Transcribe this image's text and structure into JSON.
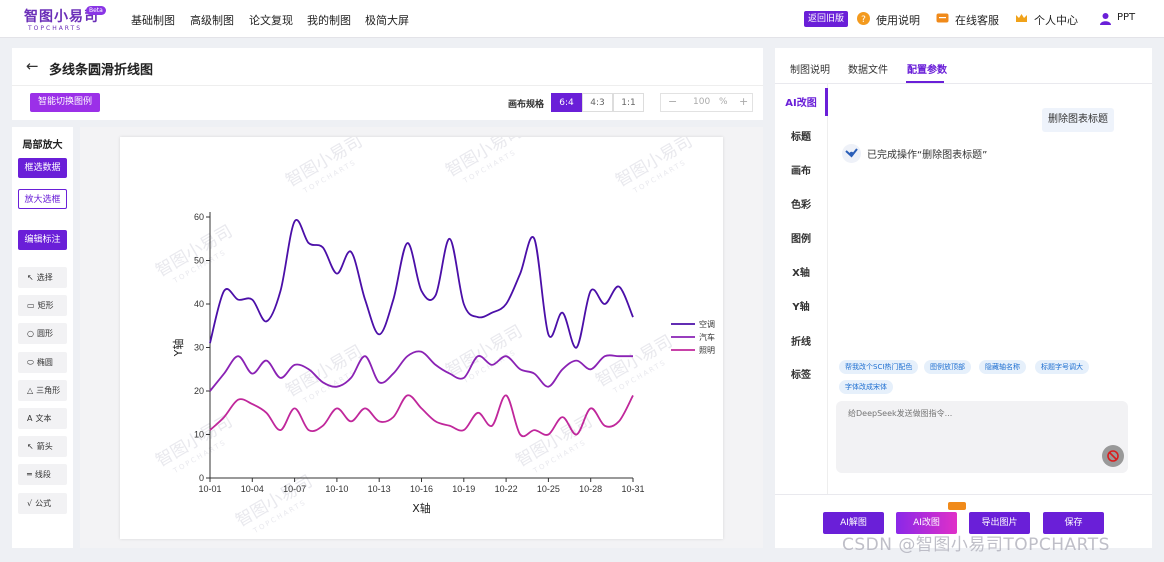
{
  "brand": {
    "name": "智图小易司",
    "sub": "TOPCHARTS",
    "badge": "Beta"
  },
  "nav": [
    "基础制图",
    "高级制图",
    "论文复现",
    "我的制图",
    "极简大屏"
  ],
  "topbar": {
    "old_version": "返回旧版",
    "help": "使用说明",
    "service": "在线客服",
    "center": "个人中心",
    "user": "PPT"
  },
  "page": {
    "title": "多线条圆滑折线图",
    "smart_switch": "智能切换图例"
  },
  "canvas": {
    "ratio_label": "画布规格",
    "ratios": [
      "6:4",
      "4:3",
      "1:1"
    ],
    "active_ratio": "6:4",
    "zoom_minus": "−",
    "zoom_value": "100",
    "zoom_unit": "%",
    "zoom_plus": "+"
  },
  "left_tools": {
    "heading": "局部放大",
    "select_data": "框选数据",
    "zoom_box": "放大选框",
    "edit_annot": "编辑标注",
    "shapes": [
      {
        "label": "选择",
        "icon": "cursor-icon"
      },
      {
        "label": "矩形",
        "icon": "rectangle-icon"
      },
      {
        "label": "圆形",
        "icon": "circle-icon"
      },
      {
        "label": "椭圆",
        "icon": "ellipse-icon"
      },
      {
        "label": "三角形",
        "icon": "triangle-icon"
      },
      {
        "label": "文本",
        "icon": "text-icon"
      },
      {
        "label": "箭头",
        "icon": "arrow-icon"
      },
      {
        "label": "线段",
        "icon": "line-icon"
      },
      {
        "label": "公式",
        "icon": "formula-icon"
      }
    ]
  },
  "right_panel": {
    "tabs": [
      "制图说明",
      "数据文件",
      "配置参数"
    ],
    "active_tab": "配置参数",
    "side_menu": [
      "AI改图",
      "标题",
      "画布",
      "色彩",
      "图例",
      "X轴",
      "Y轴",
      "折线",
      "标签"
    ],
    "user_message": "删除图表标题",
    "ai_reply": "已完成操作“删除图表标题”",
    "chips": [
      "帮我改个SCI热门配色",
      "图例放顶部",
      "隐藏轴名称",
      "标题字号调大",
      "字体改成宋体"
    ],
    "prompt_placeholder": "给DeepSeek发送做图指令...",
    "actions": {
      "ai_explain": "AI解图",
      "ai_edit": "AI改图",
      "export": "导出图片",
      "save": "保存"
    }
  },
  "footer_watermark": "CSDN @智图小易司TOPCHARTS",
  "chart_watermark": "智图小易司",
  "chart_watermark_sub": "TOPCHARTS",
  "colors": {
    "accent": "#6a1fd8",
    "line1": "#4b0fa8",
    "line2": "#8a22b4",
    "line3": "#c0279b"
  },
  "chart_data": {
    "type": "line",
    "xlabel": "X轴",
    "ylabel": "Y轴",
    "ylim": [
      0,
      60
    ],
    "yticks": [
      0,
      10,
      20,
      30,
      40,
      50,
      60
    ],
    "x_tick_labels": [
      "10-01",
      "10-04",
      "10-07",
      "10-10",
      "10-13",
      "10-16",
      "10-19",
      "10-22",
      "10-25",
      "10-28",
      "10-31"
    ],
    "x": [
      "10-01",
      "10-02",
      "10-03",
      "10-04",
      "10-05",
      "10-06",
      "10-07",
      "10-08",
      "10-09",
      "10-10",
      "10-11",
      "10-12",
      "10-13",
      "10-14",
      "10-15",
      "10-16",
      "10-17",
      "10-18",
      "10-19",
      "10-20",
      "10-21",
      "10-22",
      "10-23",
      "10-24",
      "10-25",
      "10-26",
      "10-27",
      "10-28",
      "10-29",
      "10-30",
      "10-31"
    ],
    "legend_position": "right",
    "series": [
      {
        "name": "空调",
        "values": [
          31,
          43,
          41,
          41,
          36,
          43,
          59,
          54,
          53,
          47,
          52,
          41,
          33,
          41,
          54,
          43,
          42,
          55,
          40,
          37,
          38,
          40,
          47,
          55,
          33,
          38,
          30,
          43,
          40,
          44,
          37
        ]
      },
      {
        "name": "汽车",
        "values": [
          20,
          24,
          28,
          24,
          27,
          23,
          26,
          25,
          22,
          21,
          23,
          28,
          22,
          24,
          28,
          29,
          26,
          24,
          23,
          28,
          26,
          28,
          25,
          24,
          21,
          25,
          27,
          25,
          28,
          28,
          28
        ]
      },
      {
        "name": "照明",
        "values": [
          11,
          14,
          18,
          17,
          15,
          11,
          16,
          11,
          12,
          16,
          13,
          16,
          13,
          14,
          19,
          16,
          13,
          12,
          11,
          15,
          12,
          19,
          10,
          11,
          10,
          14,
          10,
          16,
          12,
          13,
          19
        ]
      }
    ]
  }
}
